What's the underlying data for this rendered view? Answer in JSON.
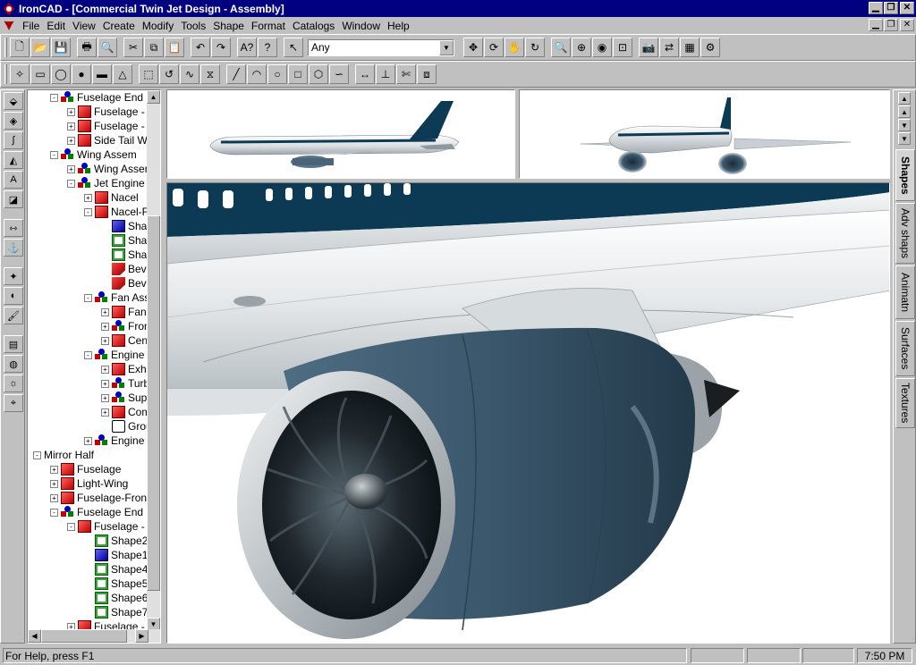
{
  "window": {
    "app_name": "IronCAD",
    "title": "IronCAD - [Commercial Twin Jet Design - Assembly]",
    "app_icon": "ironcad-logo-icon"
  },
  "menu": [
    "File",
    "Edit",
    "View",
    "Create",
    "Modify",
    "Tools",
    "Shape",
    "Format",
    "Catalogs",
    "Window",
    "Help"
  ],
  "toolbar1": {
    "buttons": [
      "new-icon",
      "open-icon",
      "save-icon",
      "print-icon",
      "print-preview-icon",
      "cut-icon",
      "copy-icon",
      "paste-icon",
      "undo-icon",
      "redo-icon",
      "interactive-help-icon",
      "whats-this-icon",
      "select-pointer-icon"
    ],
    "selection_filter": "Any",
    "right_buttons": [
      "move-icon",
      "orbit-icon",
      "pan-icon",
      "roll-icon",
      "zoom-icon",
      "zoom-window-icon",
      "look-at-icon",
      "fit-view-icon",
      "camera-icon",
      "walk-icon",
      "render-icon",
      "view-settings-icon"
    ]
  },
  "toolbar2": {
    "buttons": [
      "triball-icon",
      "box-icon",
      "cylinder-icon",
      "sphere-icon",
      "slab-icon",
      "cone-icon",
      "extrude-icon",
      "spin-icon",
      "sweep-icon",
      "loft-icon",
      "line-icon",
      "arc-icon",
      "circle-icon",
      "rectangle-icon",
      "polygon-icon",
      "bspline-icon",
      "dimension-icon",
      "constraint-icon",
      "trim-icon",
      "offset-icon"
    ]
  },
  "left_tools": [
    "sketch-extrude-icon",
    "shape-icon",
    "curve-icon",
    "surface-icon",
    "text-icon",
    "decal-icon",
    "smart-dim-icon",
    "anchor-icon",
    "triball-tool-icon",
    "color-icon",
    "paint-icon",
    "texture-icon",
    "bump-icon",
    "light-icon",
    "camera-tool-icon"
  ],
  "tree": [
    {
      "label": "Fuselage End",
      "indent": 1,
      "icon": "asm",
      "expand": "-"
    },
    {
      "label": "Fuselage - E",
      "indent": 2,
      "icon": "red",
      "expand": "+"
    },
    {
      "label": "Fuselage - E",
      "indent": 2,
      "icon": "red",
      "expand": "+"
    },
    {
      "label": "Side Tail Wi",
      "indent": 2,
      "icon": "red",
      "expand": "+"
    },
    {
      "label": "Wing Assem",
      "indent": 1,
      "icon": "asm",
      "expand": "-"
    },
    {
      "label": "Wing Assem",
      "indent": 2,
      "icon": "asm",
      "expand": "+"
    },
    {
      "label": "Jet Engine",
      "indent": 2,
      "icon": "asm",
      "expand": "-"
    },
    {
      "label": "Nacel",
      "indent": 3,
      "icon": "red",
      "expand": "+"
    },
    {
      "label": "Nacel-F",
      "indent": 3,
      "icon": "red",
      "expand": "-"
    },
    {
      "label": "Sha",
      "indent": 4,
      "icon": "blue",
      "expand": ""
    },
    {
      "label": "Sha",
      "indent": 4,
      "icon": "green",
      "expand": ""
    },
    {
      "label": "Sha",
      "indent": 4,
      "icon": "green",
      "expand": ""
    },
    {
      "label": "Bev",
      "indent": 4,
      "icon": "bevel",
      "expand": ""
    },
    {
      "label": "Bev",
      "indent": 4,
      "icon": "bevel",
      "expand": ""
    },
    {
      "label": "Fan Ass",
      "indent": 3,
      "icon": "asm",
      "expand": "-"
    },
    {
      "label": "Fan",
      "indent": 4,
      "icon": "red",
      "expand": "+"
    },
    {
      "label": "Fron",
      "indent": 4,
      "icon": "asm",
      "expand": "+"
    },
    {
      "label": "Cen",
      "indent": 4,
      "icon": "red",
      "expand": "+"
    },
    {
      "label": "Engine I",
      "indent": 3,
      "icon": "asm",
      "expand": "-"
    },
    {
      "label": "Exh",
      "indent": 4,
      "icon": "red",
      "expand": "+"
    },
    {
      "label": "Turb",
      "indent": 4,
      "icon": "asm",
      "expand": "+"
    },
    {
      "label": "Sup",
      "indent": 4,
      "icon": "asm",
      "expand": "+"
    },
    {
      "label": "Com",
      "indent": 4,
      "icon": "red",
      "expand": "+"
    },
    {
      "label": "Grou",
      "indent": 4,
      "icon": "group",
      "expand": ""
    },
    {
      "label": "Engine I",
      "indent": 3,
      "icon": "asm",
      "expand": "+"
    },
    {
      "label": "Mirror Half",
      "indent": 0,
      "icon": "none",
      "expand": "-"
    },
    {
      "label": "Fuselage",
      "indent": 1,
      "icon": "red",
      "expand": "+"
    },
    {
      "label": "Light-Wing",
      "indent": 1,
      "icon": "red",
      "expand": "+"
    },
    {
      "label": "Fuselage-Front",
      "indent": 1,
      "icon": "red",
      "expand": "+"
    },
    {
      "label": "Fuselage End",
      "indent": 1,
      "icon": "asm",
      "expand": "-"
    },
    {
      "label": "Fuselage - E",
      "indent": 2,
      "icon": "red",
      "expand": "-"
    },
    {
      "label": "Shape2",
      "indent": 3,
      "icon": "green",
      "expand": ""
    },
    {
      "label": "Shape1",
      "indent": 3,
      "icon": "blue",
      "expand": ""
    },
    {
      "label": "Shape4",
      "indent": 3,
      "icon": "green",
      "expand": ""
    },
    {
      "label": "Shape5",
      "indent": 3,
      "icon": "green",
      "expand": ""
    },
    {
      "label": "Shape6",
      "indent": 3,
      "icon": "green",
      "expand": ""
    },
    {
      "label": "Shape7",
      "indent": 3,
      "icon": "green",
      "expand": ""
    },
    {
      "label": "Fuselage - E",
      "indent": 2,
      "icon": "red",
      "expand": "+"
    }
  ],
  "right_tabs": [
    "Shapes",
    "Adv shaps",
    "Animatn",
    "Surfaces",
    "Textures"
  ],
  "status": {
    "help": "For Help, press F1",
    "time": "7:50 PM"
  },
  "colors": {
    "title_bg": "#000080",
    "face": "#c0c0c0",
    "nacelle": "#3d5a70",
    "livery": "#0c3a55"
  }
}
